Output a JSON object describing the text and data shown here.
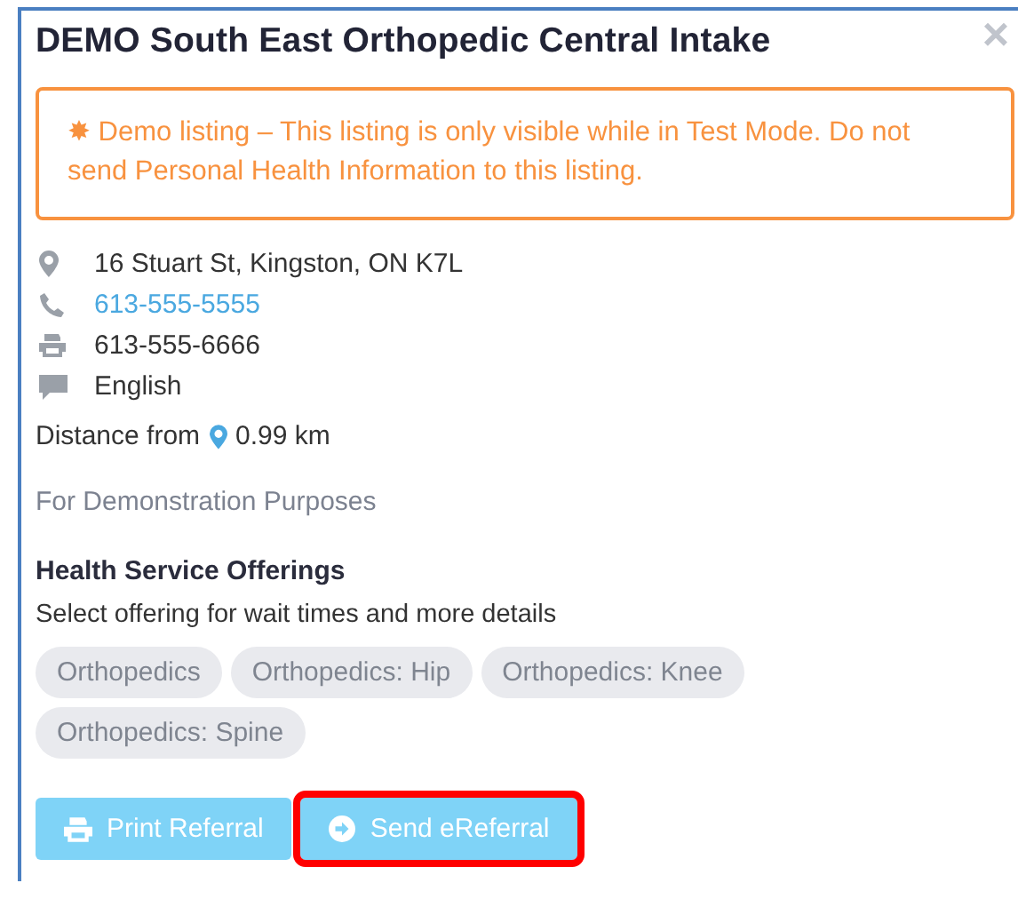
{
  "title": "DEMO South East Orthopedic Central Intake",
  "close": "×",
  "alert": {
    "icon": "✸",
    "text": "Demo listing – This listing is only visible while in Test Mode. Do not send Personal Health Information to this listing."
  },
  "contacts": [
    {
      "kind": "address",
      "text": "16 Stuart St, Kingston, ON K7L"
    },
    {
      "kind": "phone",
      "text": "613-555-5555"
    },
    {
      "kind": "fax",
      "text": "613-555-6666"
    },
    {
      "kind": "language",
      "text": "English"
    }
  ],
  "distance": {
    "label": "Distance from",
    "value": "0.99 km"
  },
  "note": "For Demonstration Purposes",
  "offerings": {
    "heading": "Health Service Offerings",
    "hint": "Select offering for wait times and more details",
    "items": [
      "Orthopedics",
      "Orthopedics: Hip",
      "Orthopedics: Knee",
      "Orthopedics: Spine"
    ]
  },
  "buttons": [
    {
      "kind": "print",
      "label": "Print Referral",
      "highlighted": false
    },
    {
      "kind": "send",
      "label": "Send eReferral",
      "highlighted": true
    }
  ]
}
